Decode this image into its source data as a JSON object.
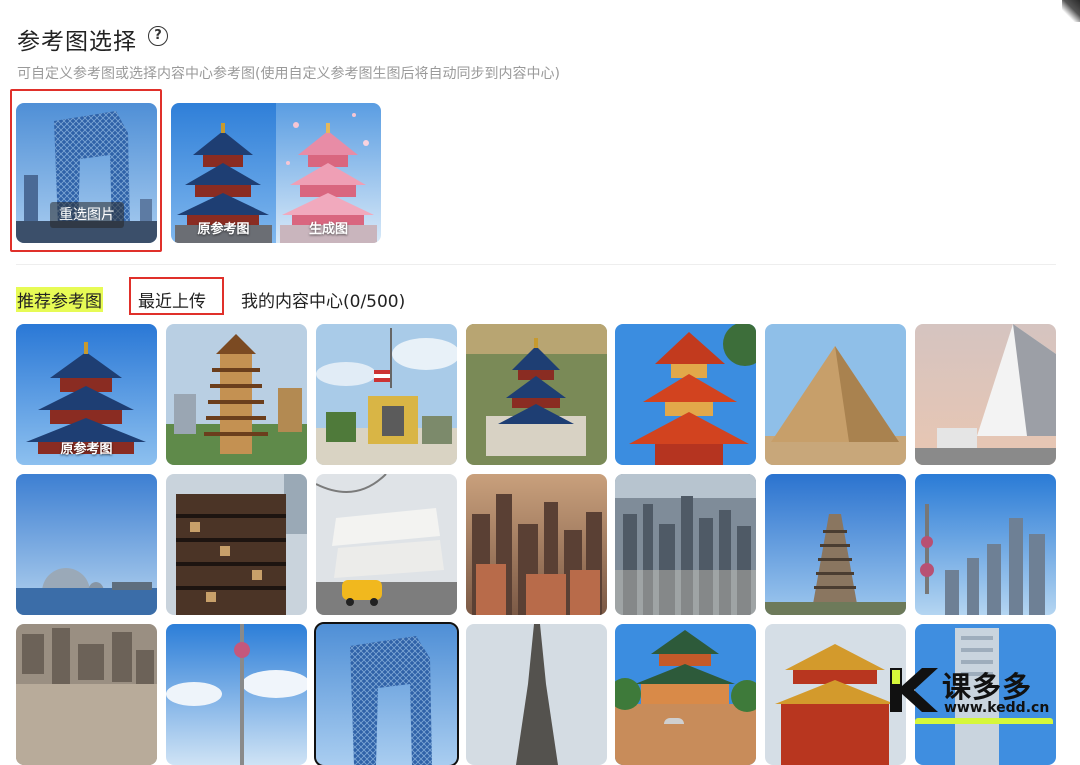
{
  "header": {
    "title": "参考图选择",
    "help_icon": "?",
    "subtitle": "可自定义参考图或选择内容中心参考图(使用自定义参考图生图后将自动同步到内容中心)"
  },
  "reference": {
    "reselect_label": "重选图片",
    "original_label": "原参考图",
    "generated_label": "生成图"
  },
  "tabs": [
    {
      "label": "推荐参考图"
    },
    {
      "label": "最近上传"
    },
    {
      "label": "我的内容中心(0/500)"
    }
  ],
  "grid": {
    "first_tile_label": "原参考图",
    "tiles": [
      "temple-of-heaven",
      "pagoda-tower",
      "thai-monument",
      "temple-of-heaven-aerial",
      "red-pagoda",
      "pyramid",
      "white-church",
      "opera-house-dome",
      "chongqing-building",
      "guggenheim-museum",
      "city-skyline-dusk",
      "manhattan-aerial",
      "wild-goose-pagoda",
      "shanghai-skyline",
      "city-aerial",
      "pearl-tower",
      "cctv-building",
      "eiffel-tower",
      "chinese-pavilion",
      "forbidden-city-gate",
      "office-tower"
    ]
  },
  "watermark": {
    "text": "课多多",
    "url": "www.kedd.cn"
  },
  "colors": {
    "highlight_red": "#e0302a",
    "tab_highlight": "#e7fb55"
  }
}
